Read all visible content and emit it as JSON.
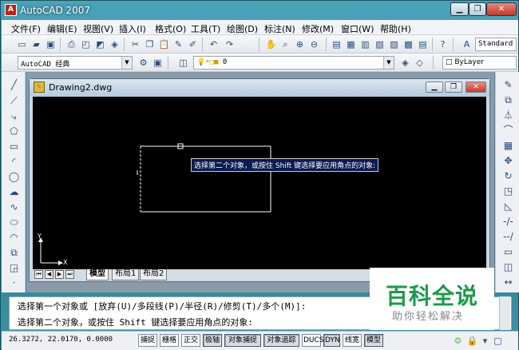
{
  "app": {
    "title": "AutoCAD 2007"
  },
  "menu": [
    "文件(F)",
    "编辑(E)",
    "视图(V)",
    "插入(I)",
    "格式(O)",
    "工具(T)",
    "绘图(D)",
    "标注(N)",
    "修改(M)",
    "窗口(W)",
    "帮助(H)"
  ],
  "toolbar": {
    "text_style": "Standard",
    "workspace": "AutoCAD 经典",
    "layer": "0",
    "color": "ByLayer"
  },
  "drawing": {
    "title": "Drawing2.dwg",
    "tooltip": "选择第二个对象，或按住 Shift 键选择要应用角点的对象:",
    "axis_x": "X",
    "axis_y": "Y",
    "tabs": [
      "模型",
      "布局1",
      "布局2"
    ]
  },
  "command": {
    "line1": "选择第一个对象或 [放弃(U)/多段线(P)/半径(R)/修剪(T)/多个(M)]:",
    "line2": "选择第二个对象，或按住 Shift 键选择要应用角点的对象:"
  },
  "status": {
    "coords": "26.3272, 22.0170, 0.0000",
    "buttons": [
      "捕捉",
      "栅格",
      "正交",
      "极轴",
      "对象捕捉",
      "对象追踪",
      "DUCS",
      "DYN",
      "线宽",
      "模型"
    ]
  },
  "watermark": {
    "title": "百科全说",
    "subtitle": "助你轻松解决"
  },
  "colors": {
    "canvas": "#000000",
    "tooltip_bg": "#0b1a50",
    "watermark_green": "#1c9a4a"
  }
}
